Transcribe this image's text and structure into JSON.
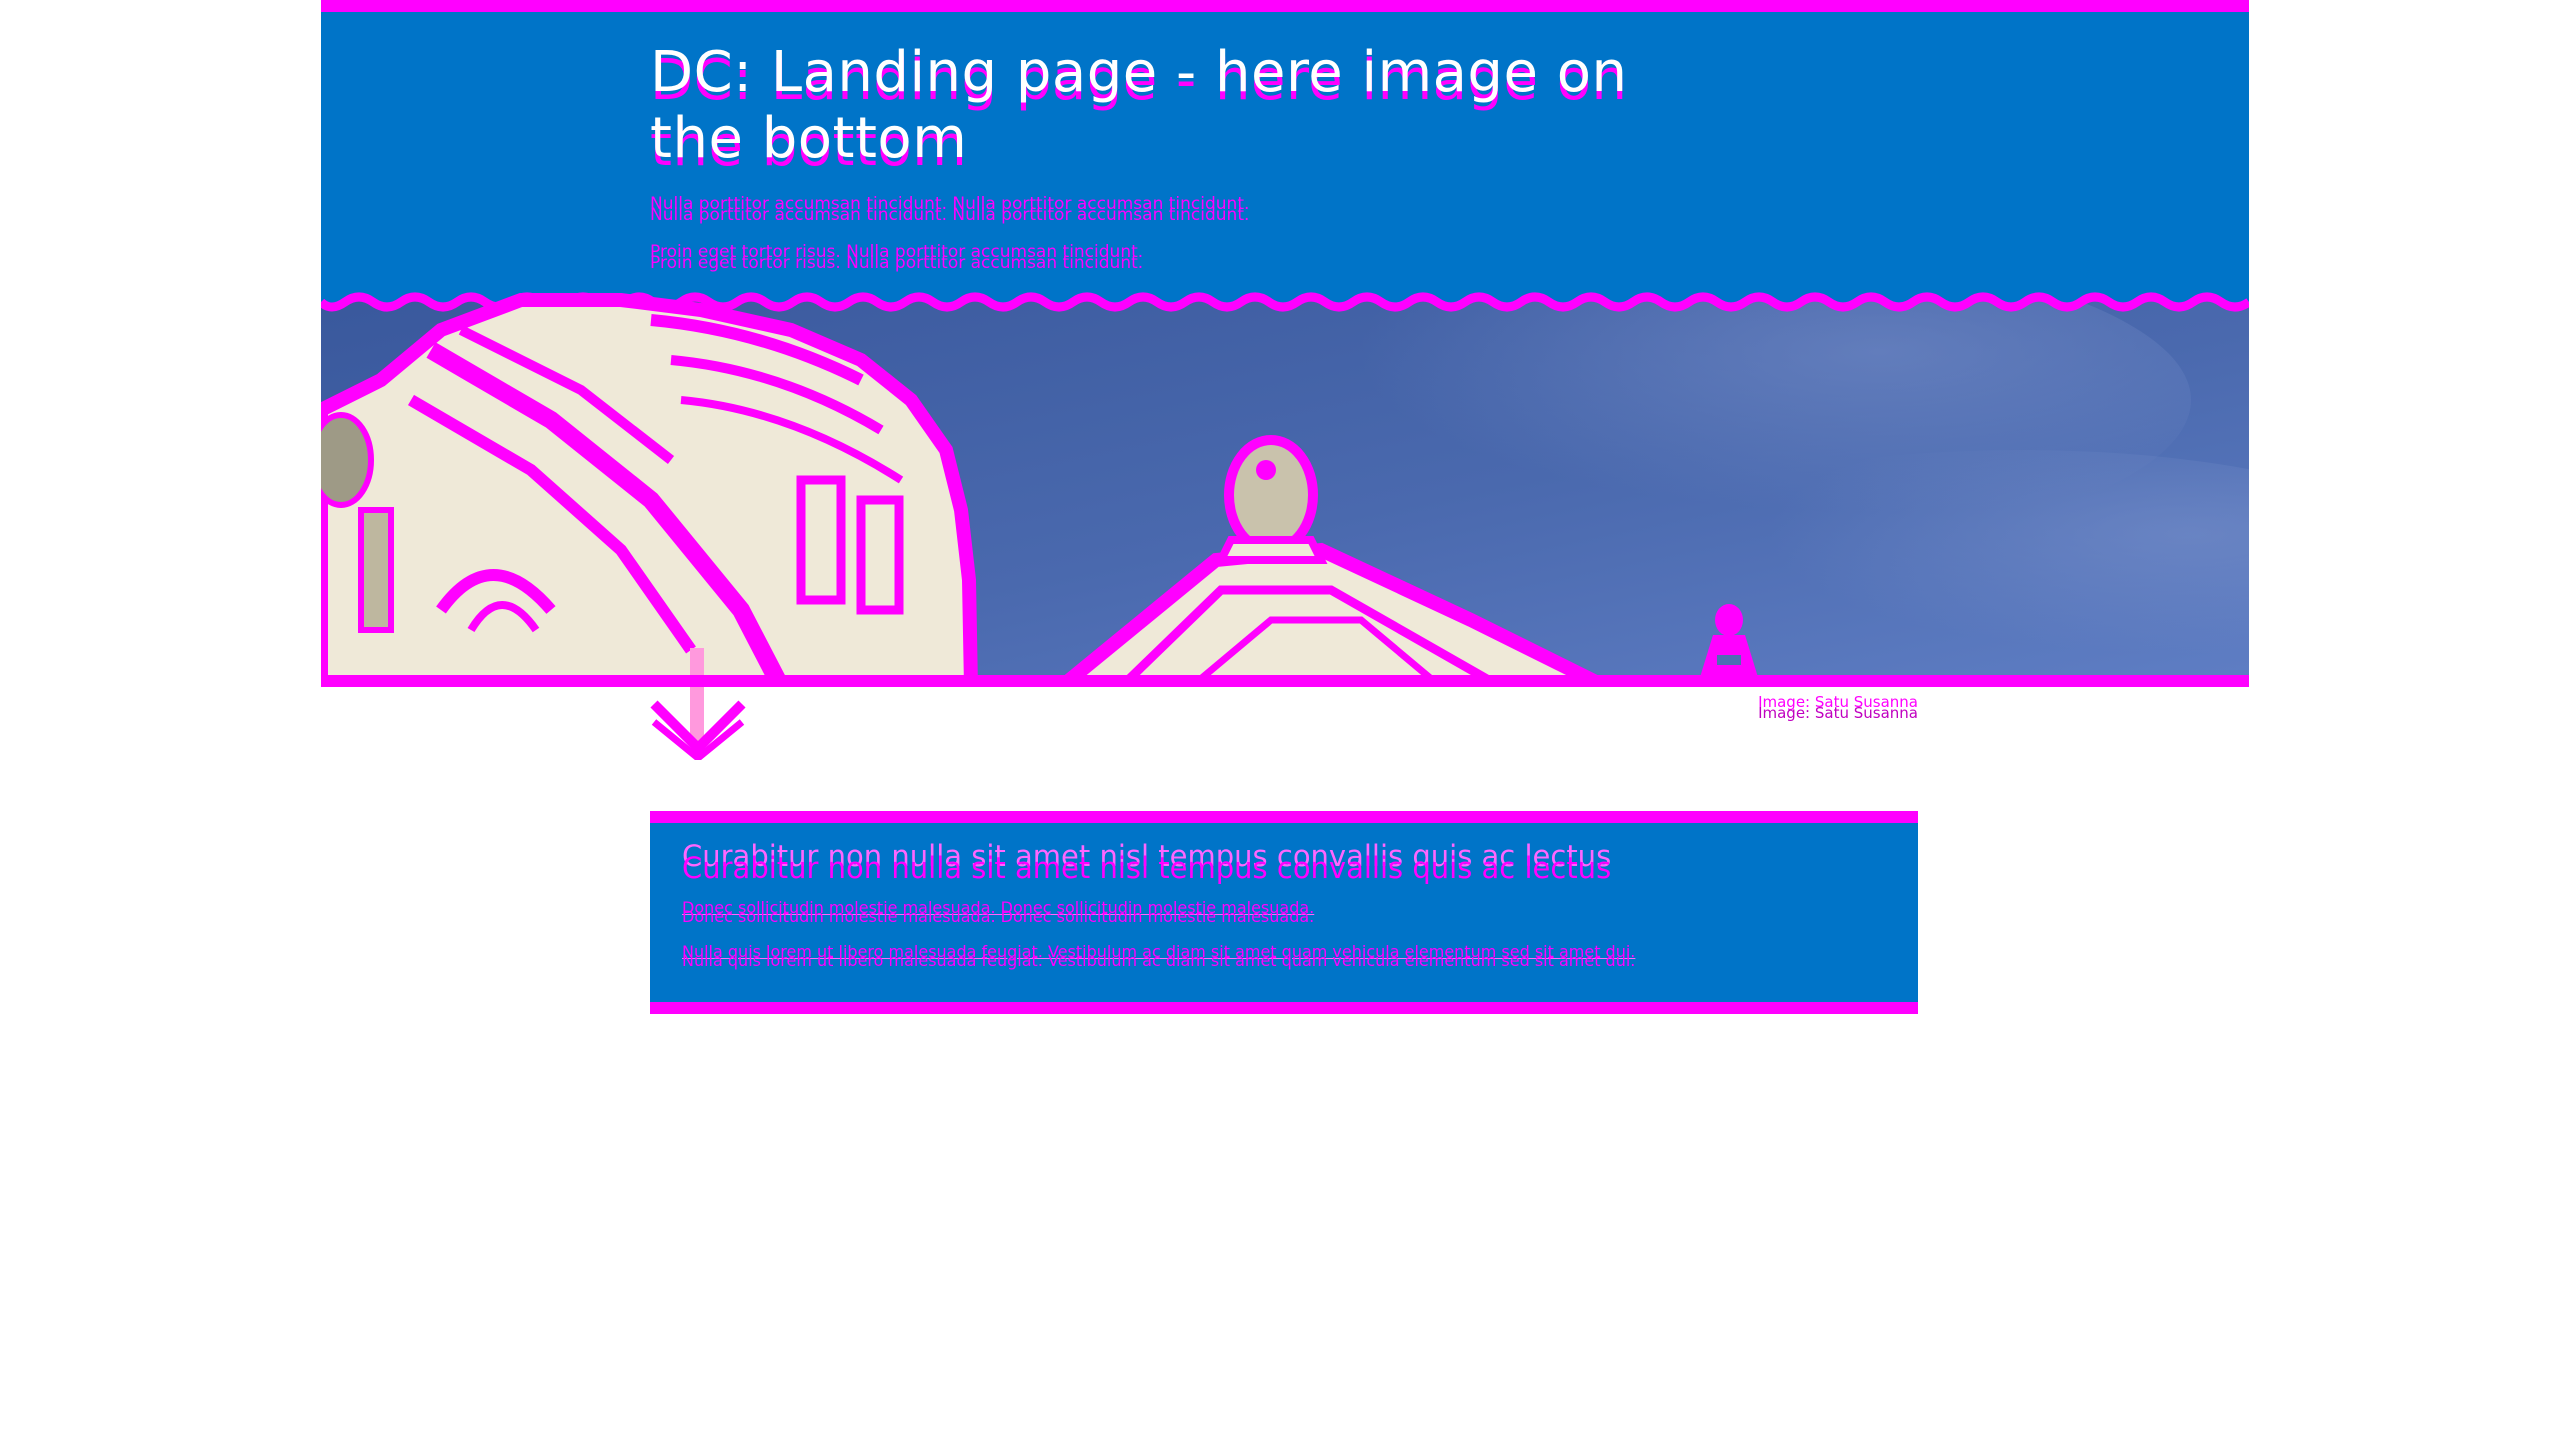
{
  "hero": {
    "title": "DC: Landing page - here image on the bottom",
    "paragraph_1": "Nulla porttitor accumsan tincidunt. Nulla porttitor accumsan tincidunt.",
    "paragraph_2": "Proin eget tortor risus. Nulla porttitor accumsan tincidunt."
  },
  "image": {
    "credit": "Image: Satu Susanna",
    "subject": "classical-domed-building-under-blue-sky"
  },
  "scroll_indicator": {
    "icon": "arrow-down-icon"
  },
  "card": {
    "title": "Curabitur non nulla sit amet nisl tempus convallis quis ac lectus",
    "paragraph_1": "Donec sollicitudin molestie malesuada. Donec sollicitudin molestie malesuada.",
    "paragraph_2": "Nulla quis lorem ut libero malesuada feugiat. Vestibulum ac diam sit amet quam vehicula elementum sed sit amet dui."
  },
  "colors": {
    "primary_blue": "#0074C8",
    "accent_magenta": "#FF00FF",
    "sky_blue": "#4E6EB4",
    "stone": "#EFE9D8"
  }
}
